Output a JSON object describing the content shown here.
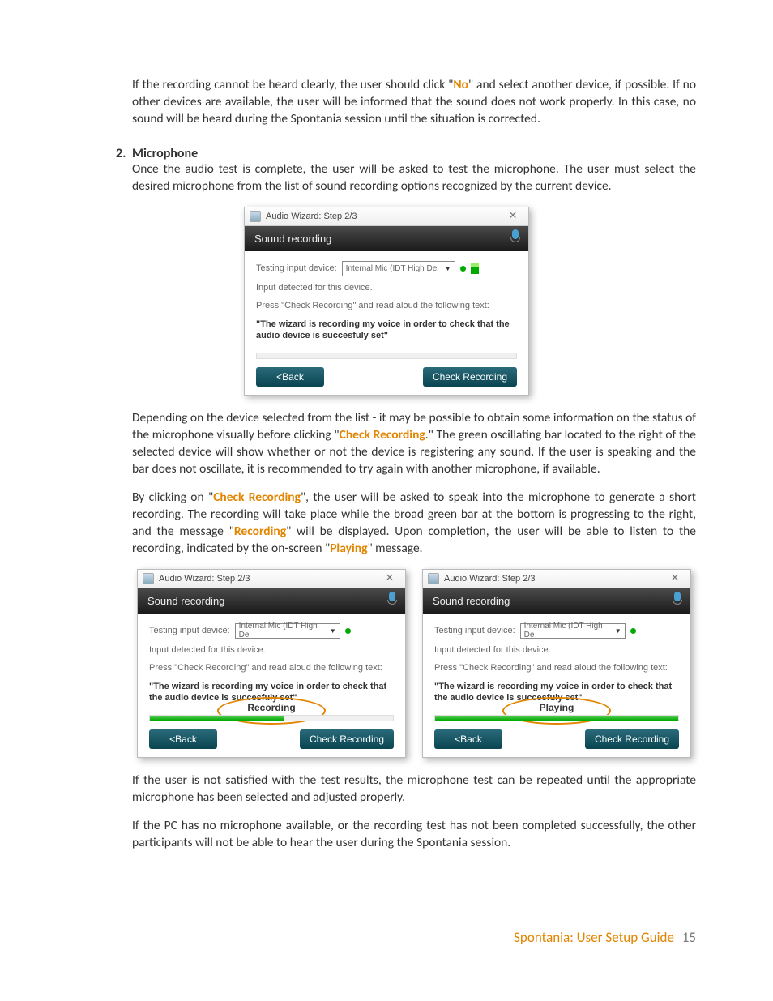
{
  "para1_a": "If the recording cannot be heard clearly, the user should click \"",
  "para1_no": "No",
  "para1_b": "\" and select another device, if possible. If no other devices are available, the user will be informed that the sound does not work properly. In this case, no sound will be heard during the Spontania session until the situation is corrected.",
  "list_num": "2.",
  "list_head": "Microphone",
  "para2": "Once the audio test is complete, the user will be asked to test the microphone. The user must select the desired microphone from the list of sound recording options recognized by the current device.",
  "para3_a": "Depending on the device selected from the list - it may be possible to obtain some information on the status of the microphone visually before clicking \"",
  "para3_hl": "Check Recording",
  "para3_b": ".\"  The green oscillating bar located to the right of the selected device will show whether or not the device is registering any sound. If the user is speaking and the bar does not oscillate, it is recommended to try again with another microphone, if available.",
  "para4_a": "By clicking on \"",
  "para4_hl1": "Check Recording",
  "para4_b": "\", the user will be asked to speak into the microphone to generate a short recording. The recording will take place while the broad green bar at the bottom is progressing to the right, and the message \"",
  "para4_hl2": "Recording",
  "para4_c": "\" will be displayed. Upon completion, the user will be able to listen to the recording, indicated by the on-screen \"",
  "para4_hl3": "Playing",
  "para4_d": "\" message.",
  "para5": "If the user is not satisfied with the test results, the microphone test can be repeated until the appropriate microphone has been selected and adjusted properly.",
  "para6": "If the PC has no microphone available, or the recording test has not been completed successfully, the other participants will not be able to hear the user during the Spontania session.",
  "footer_text": "Spontania: User Setup Guide",
  "footer_num": "15",
  "dlg": {
    "title": "Audio Wizard: Step 2/3",
    "header": "Sound recording",
    "label_device": "Testing input device:",
    "select_value": "Internal Mic (IDT High De",
    "detected": "Input detected for this device.",
    "instruction": "Press \"Check Recording\" and read aloud the following text:",
    "quote": "\"The wizard is recording my voice in order to check that the audio device is succesfuly set\"",
    "btn_back": "<Back",
    "btn_check": "Check Recording",
    "status_rec": "Recording",
    "status_play": "Playing"
  }
}
